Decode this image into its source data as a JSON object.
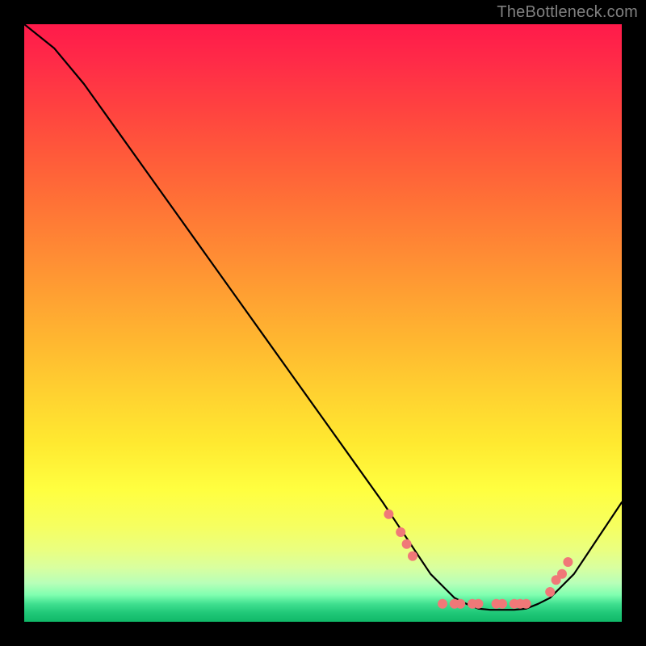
{
  "attribution": "TheBottleneck.com",
  "chart_data": {
    "type": "line",
    "title": "",
    "xlabel": "",
    "ylabel": "",
    "x": [
      0,
      5,
      10,
      15,
      20,
      25,
      30,
      35,
      40,
      45,
      50,
      55,
      60,
      62,
      64,
      66,
      68,
      70,
      72,
      74,
      76,
      78,
      80,
      82,
      84,
      86,
      88,
      90,
      92,
      94,
      96,
      100
    ],
    "values": [
      100,
      96,
      90,
      83,
      76,
      69,
      62,
      55,
      48,
      41,
      34,
      27,
      20,
      17,
      14,
      11,
      8,
      6,
      4,
      3,
      2.2,
      2,
      2,
      2,
      2.2,
      3,
      4,
      6,
      8,
      11,
      14,
      20
    ],
    "xlim": [
      0,
      100
    ],
    "ylim": [
      0,
      100
    ],
    "points": [
      {
        "x": 61,
        "y": 18
      },
      {
        "x": 63,
        "y": 15
      },
      {
        "x": 64,
        "y": 13
      },
      {
        "x": 65,
        "y": 11
      },
      {
        "x": 70,
        "y": 3
      },
      {
        "x": 72,
        "y": 3
      },
      {
        "x": 73,
        "y": 3
      },
      {
        "x": 75,
        "y": 3
      },
      {
        "x": 76,
        "y": 3
      },
      {
        "x": 79,
        "y": 3
      },
      {
        "x": 80,
        "y": 3
      },
      {
        "x": 82,
        "y": 3
      },
      {
        "x": 83,
        "y": 3
      },
      {
        "x": 84,
        "y": 3
      },
      {
        "x": 88,
        "y": 5
      },
      {
        "x": 89,
        "y": 7
      },
      {
        "x": 90,
        "y": 8
      },
      {
        "x": 91,
        "y": 10
      }
    ],
    "gradient_stops": [
      {
        "offset": 0.0,
        "color": "#ff1a4a"
      },
      {
        "offset": 0.06,
        "color": "#ff2a48"
      },
      {
        "offset": 0.14,
        "color": "#ff4240"
      },
      {
        "offset": 0.22,
        "color": "#ff5a3a"
      },
      {
        "offset": 0.3,
        "color": "#ff7236"
      },
      {
        "offset": 0.38,
        "color": "#ff8a34"
      },
      {
        "offset": 0.46,
        "color": "#ffa232"
      },
      {
        "offset": 0.54,
        "color": "#ffba30"
      },
      {
        "offset": 0.62,
        "color": "#ffd230"
      },
      {
        "offset": 0.7,
        "color": "#ffe930"
      },
      {
        "offset": 0.78,
        "color": "#ffff40"
      },
      {
        "offset": 0.84,
        "color": "#f6ff60"
      },
      {
        "offset": 0.88,
        "color": "#eaff80"
      },
      {
        "offset": 0.91,
        "color": "#d8ffa0"
      },
      {
        "offset": 0.935,
        "color": "#b8ffb8"
      },
      {
        "offset": 0.955,
        "color": "#80ffb0"
      },
      {
        "offset": 0.97,
        "color": "#40e090"
      },
      {
        "offset": 0.985,
        "color": "#20c878"
      },
      {
        "offset": 1.0,
        "color": "#10b868"
      }
    ],
    "point_color": "#f07878",
    "line_color": "#000000"
  }
}
